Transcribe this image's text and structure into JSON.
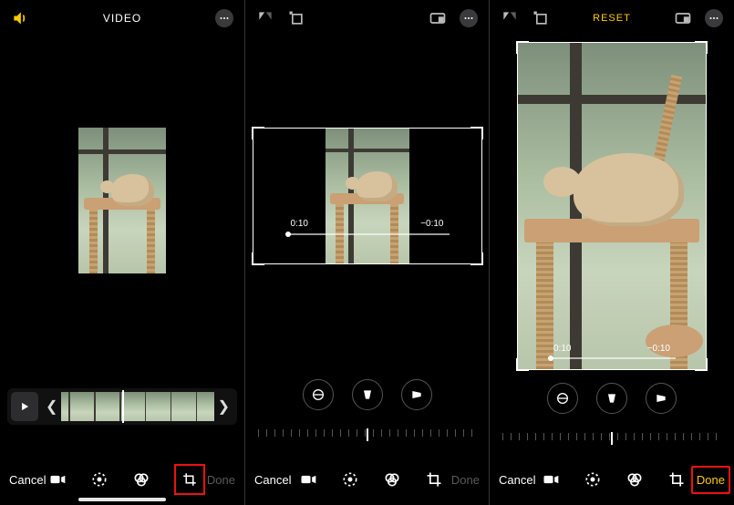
{
  "panel1": {
    "header_title": "VIDEO",
    "bottom": {
      "cancel": "Cancel",
      "done": "Done"
    }
  },
  "panel2": {
    "time_start": "0:10",
    "time_end": "−0:10",
    "bottom": {
      "cancel": "Cancel",
      "done": "Done"
    }
  },
  "panel3": {
    "reset": "RESET",
    "time_start": "0:10",
    "time_end": "−0:10",
    "bottom": {
      "cancel": "Cancel",
      "done": "Done"
    }
  }
}
